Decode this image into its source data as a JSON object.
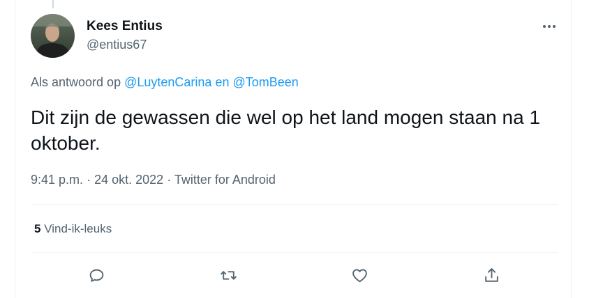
{
  "author": {
    "name": "Kees Entius",
    "handle": "@entius67"
  },
  "reply_context": {
    "prefix": "Als antwoord op",
    "mention_1": "@LuytenCarina",
    "conjunction": "en",
    "mention_2": "@TomBeen"
  },
  "tweet": {
    "text": "Dit zijn de gewassen die wel op het land mogen staan na 1 oktober.",
    "time": "9:41 p.m.",
    "date": "24 okt. 2022",
    "source": "Twitter for Android",
    "separator": "·"
  },
  "stats": {
    "likes_count": "5",
    "likes_label": "Vind-ik-leuks"
  },
  "actions": [
    "reply-icon",
    "retweet-icon",
    "like-icon",
    "share-icon"
  ],
  "colors": {
    "text": "#0f1419",
    "secondary": "#536471",
    "link": "#1d9bf0",
    "divider": "#eff3f4"
  }
}
